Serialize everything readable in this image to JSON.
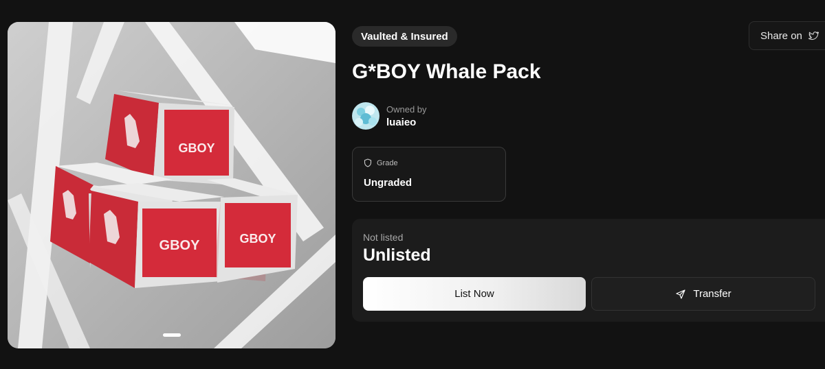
{
  "badge": {
    "label": "Vaulted & Insured"
  },
  "share": {
    "label": "Share on",
    "icon": "twitter-icon"
  },
  "item": {
    "title": "G*BOY Whale Pack"
  },
  "owner": {
    "label": "Owned by",
    "name": "luaieo"
  },
  "grade": {
    "label": "Grade",
    "value": "Ungraded",
    "icon": "shield-icon"
  },
  "listing": {
    "status": "Not listed",
    "value": "Unlisted"
  },
  "actions": {
    "list_label": "List Now",
    "transfer_label": "Transfer",
    "transfer_icon": "send-icon"
  },
  "media": {
    "box_label": "GBOY",
    "accent": "#d42b3a"
  },
  "colors": {
    "background": "#121212",
    "card": "#1c1c1c"
  }
}
